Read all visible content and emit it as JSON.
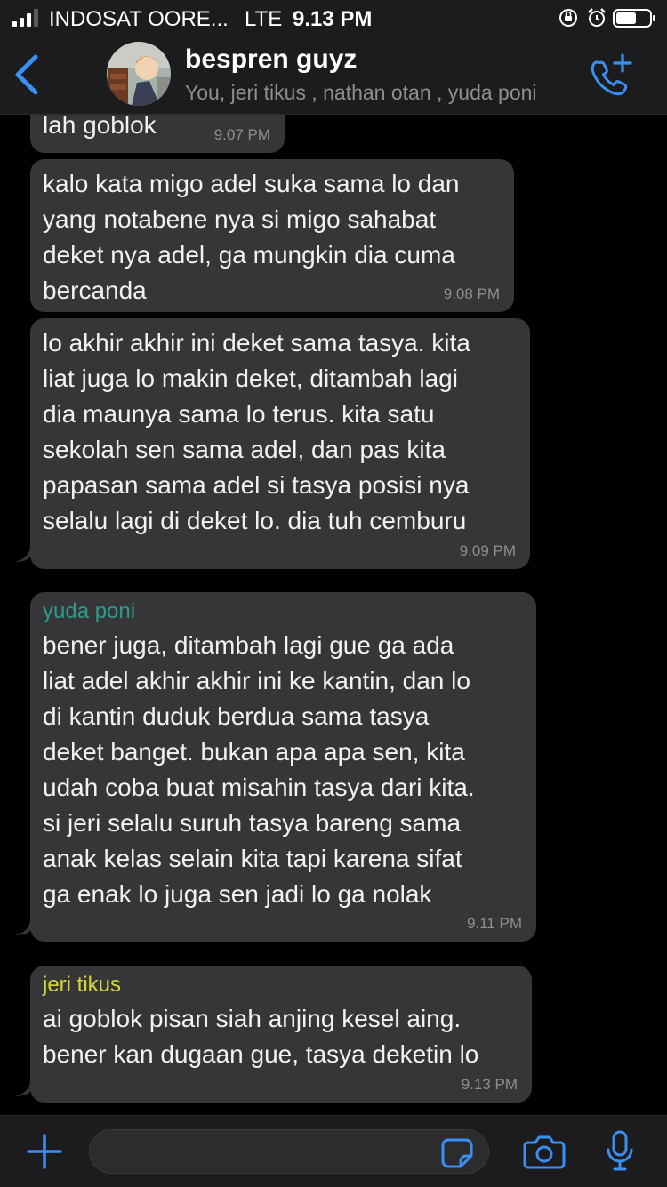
{
  "status_bar": {
    "carrier": "INDOSAT OORE...",
    "network": "LTE",
    "time": "9.13 PM",
    "icons": [
      "signal-icon",
      "orientation-lock-icon",
      "alarm-icon",
      "battery-icon"
    ]
  },
  "header": {
    "title": "bespren guyz",
    "members": "You, jeri tikus , nathan otan , yuda poni",
    "icons": [
      "back-chevron-icon",
      "group-avatar",
      "add-call-icon"
    ]
  },
  "messages": [
    {
      "text": "lah goblok",
      "time": "9.07 PM"
    },
    {
      "text": "kalo kata migo adel suka sama lo dan\nyang notabene nya si migo sahabat\ndeket nya adel, ga mungkin dia cuma\nbercanda",
      "time": "9.08 PM"
    },
    {
      "text": "lo akhir akhir ini deket sama tasya. kita\nliat juga lo makin deket, ditambah lagi\ndia maunya sama lo terus. kita satu\nsekolah sen sama adel, dan pas kita\npapasan sama adel si tasya posisi nya\nselalu lagi di deket lo. dia tuh cemburu",
      "time": "9.09 PM"
    },
    {
      "sender": "yuda poni",
      "sender_color": "#2a9d8a",
      "text": "bener juga, ditambah lagi gue ga ada\nliat adel akhir akhir ini ke kantin, dan lo\ndi kantin duduk berdua sama tasya\ndeket banget. bukan apa apa sen, kita\nudah coba buat misahin tasya dari kita.\nsi jeri selalu suruh tasya bareng sama\nanak kelas selain kita tapi karena sifat\nga enak lo juga sen jadi lo ga nolak",
      "time": "9.11 PM"
    },
    {
      "sender": "jeri tikus",
      "sender_color": "#d6d83a",
      "text": "ai goblok pisan siah anjing kesel aing.\nbener kan dugaan gue, tasya deketin lo",
      "time": "9.13 PM"
    }
  ],
  "input_bar": {
    "icons": [
      "plus-icon",
      "sticker-icon",
      "camera-icon",
      "microphone-icon"
    ]
  },
  "colors": {
    "accent": "#3a8ff5",
    "bubble": "#363638",
    "bar": "#1c1c1e"
  }
}
